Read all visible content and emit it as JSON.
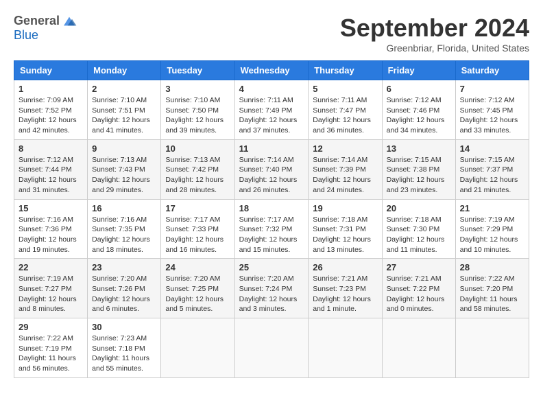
{
  "header": {
    "logo_general": "General",
    "logo_blue": "Blue",
    "month_title": "September 2024",
    "location": "Greenbriar, Florida, United States"
  },
  "calendar": {
    "columns": [
      "Sunday",
      "Monday",
      "Tuesday",
      "Wednesday",
      "Thursday",
      "Friday",
      "Saturday"
    ],
    "weeks": [
      [
        {
          "day": "1",
          "info": "Sunrise: 7:09 AM\nSunset: 7:52 PM\nDaylight: 12 hours and 42 minutes."
        },
        {
          "day": "2",
          "info": "Sunrise: 7:10 AM\nSunset: 7:51 PM\nDaylight: 12 hours and 41 minutes."
        },
        {
          "day": "3",
          "info": "Sunrise: 7:10 AM\nSunset: 7:50 PM\nDaylight: 12 hours and 39 minutes."
        },
        {
          "day": "4",
          "info": "Sunrise: 7:11 AM\nSunset: 7:49 PM\nDaylight: 12 hours and 37 minutes."
        },
        {
          "day": "5",
          "info": "Sunrise: 7:11 AM\nSunset: 7:47 PM\nDaylight: 12 hours and 36 minutes."
        },
        {
          "day": "6",
          "info": "Sunrise: 7:12 AM\nSunset: 7:46 PM\nDaylight: 12 hours and 34 minutes."
        },
        {
          "day": "7",
          "info": "Sunrise: 7:12 AM\nSunset: 7:45 PM\nDaylight: 12 hours and 33 minutes."
        }
      ],
      [
        {
          "day": "8",
          "info": "Sunrise: 7:12 AM\nSunset: 7:44 PM\nDaylight: 12 hours and 31 minutes."
        },
        {
          "day": "9",
          "info": "Sunrise: 7:13 AM\nSunset: 7:43 PM\nDaylight: 12 hours and 29 minutes."
        },
        {
          "day": "10",
          "info": "Sunrise: 7:13 AM\nSunset: 7:42 PM\nDaylight: 12 hours and 28 minutes."
        },
        {
          "day": "11",
          "info": "Sunrise: 7:14 AM\nSunset: 7:40 PM\nDaylight: 12 hours and 26 minutes."
        },
        {
          "day": "12",
          "info": "Sunrise: 7:14 AM\nSunset: 7:39 PM\nDaylight: 12 hours and 24 minutes."
        },
        {
          "day": "13",
          "info": "Sunrise: 7:15 AM\nSunset: 7:38 PM\nDaylight: 12 hours and 23 minutes."
        },
        {
          "day": "14",
          "info": "Sunrise: 7:15 AM\nSunset: 7:37 PM\nDaylight: 12 hours and 21 minutes."
        }
      ],
      [
        {
          "day": "15",
          "info": "Sunrise: 7:16 AM\nSunset: 7:36 PM\nDaylight: 12 hours and 19 minutes."
        },
        {
          "day": "16",
          "info": "Sunrise: 7:16 AM\nSunset: 7:35 PM\nDaylight: 12 hours and 18 minutes."
        },
        {
          "day": "17",
          "info": "Sunrise: 7:17 AM\nSunset: 7:33 PM\nDaylight: 12 hours and 16 minutes."
        },
        {
          "day": "18",
          "info": "Sunrise: 7:17 AM\nSunset: 7:32 PM\nDaylight: 12 hours and 15 minutes."
        },
        {
          "day": "19",
          "info": "Sunrise: 7:18 AM\nSunset: 7:31 PM\nDaylight: 12 hours and 13 minutes."
        },
        {
          "day": "20",
          "info": "Sunrise: 7:18 AM\nSunset: 7:30 PM\nDaylight: 12 hours and 11 minutes."
        },
        {
          "day": "21",
          "info": "Sunrise: 7:19 AM\nSunset: 7:29 PM\nDaylight: 12 hours and 10 minutes."
        }
      ],
      [
        {
          "day": "22",
          "info": "Sunrise: 7:19 AM\nSunset: 7:27 PM\nDaylight: 12 hours and 8 minutes."
        },
        {
          "day": "23",
          "info": "Sunrise: 7:20 AM\nSunset: 7:26 PM\nDaylight: 12 hours and 6 minutes."
        },
        {
          "day": "24",
          "info": "Sunrise: 7:20 AM\nSunset: 7:25 PM\nDaylight: 12 hours and 5 minutes."
        },
        {
          "day": "25",
          "info": "Sunrise: 7:20 AM\nSunset: 7:24 PM\nDaylight: 12 hours and 3 minutes."
        },
        {
          "day": "26",
          "info": "Sunrise: 7:21 AM\nSunset: 7:23 PM\nDaylight: 12 hours and 1 minute."
        },
        {
          "day": "27",
          "info": "Sunrise: 7:21 AM\nSunset: 7:22 PM\nDaylight: 12 hours and 0 minutes."
        },
        {
          "day": "28",
          "info": "Sunrise: 7:22 AM\nSunset: 7:20 PM\nDaylight: 11 hours and 58 minutes."
        }
      ],
      [
        {
          "day": "29",
          "info": "Sunrise: 7:22 AM\nSunset: 7:19 PM\nDaylight: 11 hours and 56 minutes."
        },
        {
          "day": "30",
          "info": "Sunrise: 7:23 AM\nSunset: 7:18 PM\nDaylight: 11 hours and 55 minutes."
        },
        {
          "day": "",
          "info": ""
        },
        {
          "day": "",
          "info": ""
        },
        {
          "day": "",
          "info": ""
        },
        {
          "day": "",
          "info": ""
        },
        {
          "day": "",
          "info": ""
        }
      ]
    ]
  }
}
